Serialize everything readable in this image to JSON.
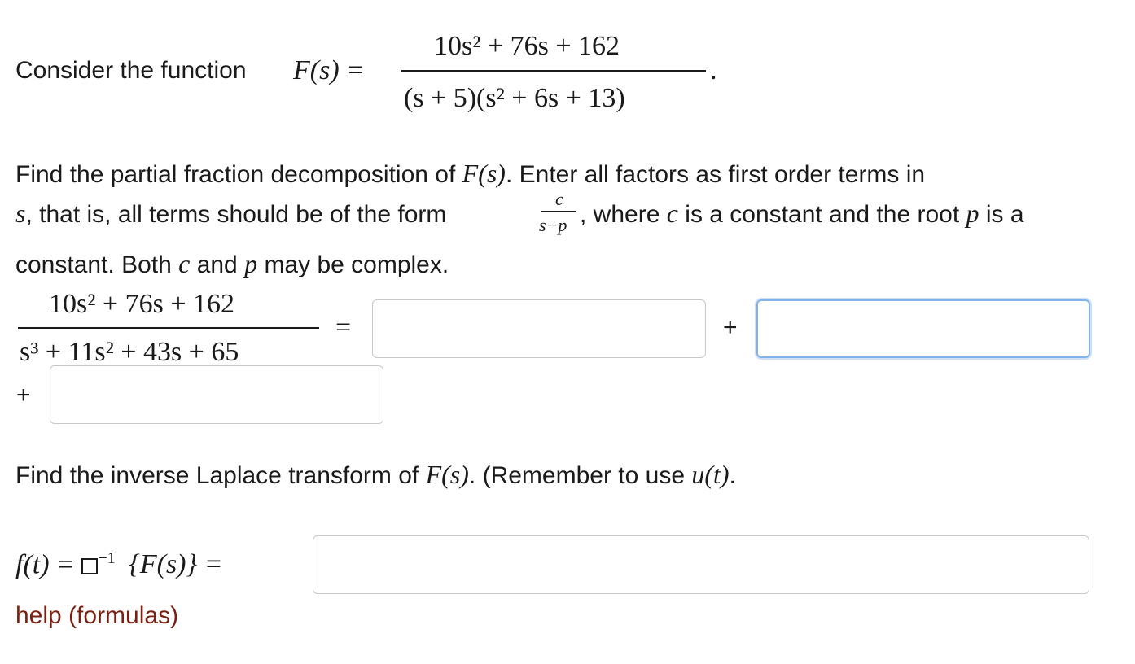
{
  "intro": {
    "prefix": "Consider the function",
    "fn": "F(s) =",
    "numerator": "10s² + 76s + 162",
    "denominator": "(s + 5)(s² + 6s + 13)",
    "suffix": "."
  },
  "instructions": {
    "line1_a": "Find the partial fraction decomposition of",
    "line1_fn": "F(s)",
    "line1_b": ". Enter all factors as first order terms in",
    "line2_s": "s",
    "line2_a": ", that is, all terms should be of the form",
    "form_num": "c",
    "form_den": "s−p",
    "line2_b": ", where",
    "line2_c": "c",
    "line2_d": "is a constant and the root",
    "line2_p": "p",
    "line2_e": "is a",
    "line3_a": "constant. Both",
    "line3_c": "c",
    "line3_b": "and",
    "line3_p": "p",
    "line3_d": "may be complex."
  },
  "decomposition": {
    "numerator": "10s² + 76s + 162",
    "denominator": "s³ + 11s² + 43s + 65",
    "equals": "=",
    "plus1": "+",
    "plus2": "+",
    "answer1": "",
    "answer2": "",
    "answer3": ""
  },
  "inverse": {
    "prompt_a": "Find the inverse Laplace transform of",
    "prompt_fn": "F(s)",
    "prompt_b": ". (Remember to use",
    "prompt_u": "u(t)",
    "prompt_c": ".",
    "lhs_a": "f(t) =",
    "lhs_sup": "−1",
    "lhs_b": "{F(s)} =",
    "answer": ""
  },
  "help": {
    "label": "help (formulas)"
  }
}
